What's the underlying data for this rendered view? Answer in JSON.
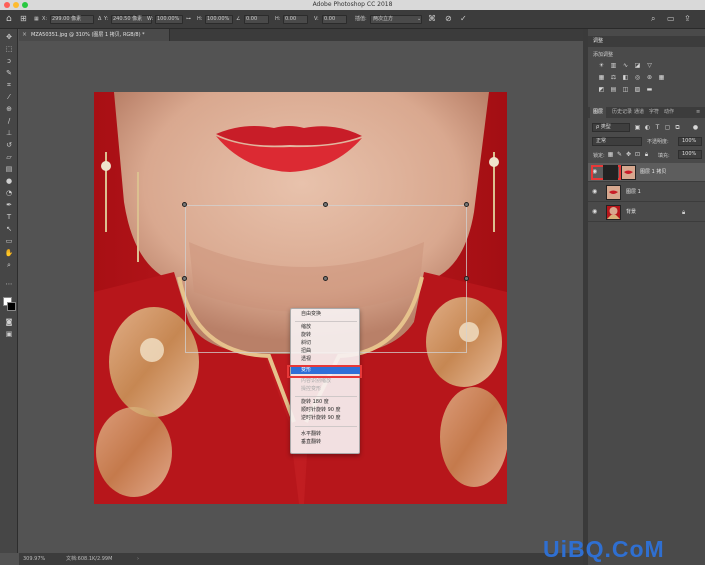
{
  "app": {
    "title": "Adobe Photoshop CC 2018"
  },
  "options_bar": {
    "x_label": "X:",
    "x_value": "299.00 像素",
    "y_label": "Y:",
    "y_value": "240.50 像素",
    "w_label": "W:",
    "w_value": "100.00%",
    "h_label": "H:",
    "h_value": "100.00%",
    "angle_value": "0.00",
    "h_skew_label": "H:",
    "h_skew_value": "0.00",
    "v_skew_label": "V:",
    "v_skew_value": "0.00",
    "interpolation_label": "插值:",
    "interpolation_value": "两次立方"
  },
  "document": {
    "tab_title": "MZA50351.jpg @ 310% (图层 1 拷贝, RGB/8) *"
  },
  "context_menu": {
    "items": [
      {
        "label": "自由变换"
      },
      {
        "label": "缩放"
      },
      {
        "label": "旋转"
      },
      {
        "label": "斜切"
      },
      {
        "label": "扭曲"
      },
      {
        "label": "透视"
      },
      {
        "label": "变形",
        "selected": true
      },
      {
        "label": "内容识别缩放"
      },
      {
        "label": "操控变形"
      },
      {
        "label": "旋转 180 度"
      },
      {
        "label": "顺时针旋转 90 度"
      },
      {
        "label": "逆时针旋转 90 度"
      },
      {
        "label": "水平翻转"
      },
      {
        "label": "垂直翻转"
      }
    ]
  },
  "status_bar": {
    "zoom": "309.97%",
    "doc_size": "文档:608.1K/2.99M"
  },
  "panels": {
    "adjustments": {
      "header": "调整",
      "subtitle": "添加调整"
    },
    "layers": {
      "tabs": [
        "图层",
        "历史记录",
        "通道",
        "字符",
        "动作"
      ],
      "filter_value": "ρ 类型",
      "blend_mode": "正常",
      "opacity_label": "不透明度:",
      "opacity_value": "100%",
      "lock_label": "锁定:",
      "fill_label": "填充:",
      "fill_value": "100%",
      "items": [
        {
          "name": "图层 1 拷贝"
        },
        {
          "name": "图层 1"
        },
        {
          "name": "背景"
        }
      ]
    }
  },
  "watermark": {
    "text": "UiBQ.CoM"
  },
  "colors": {
    "accent": "#2f6fd8",
    "highlight_outline": "#e83838",
    "watermark": "#2f6fd1"
  }
}
